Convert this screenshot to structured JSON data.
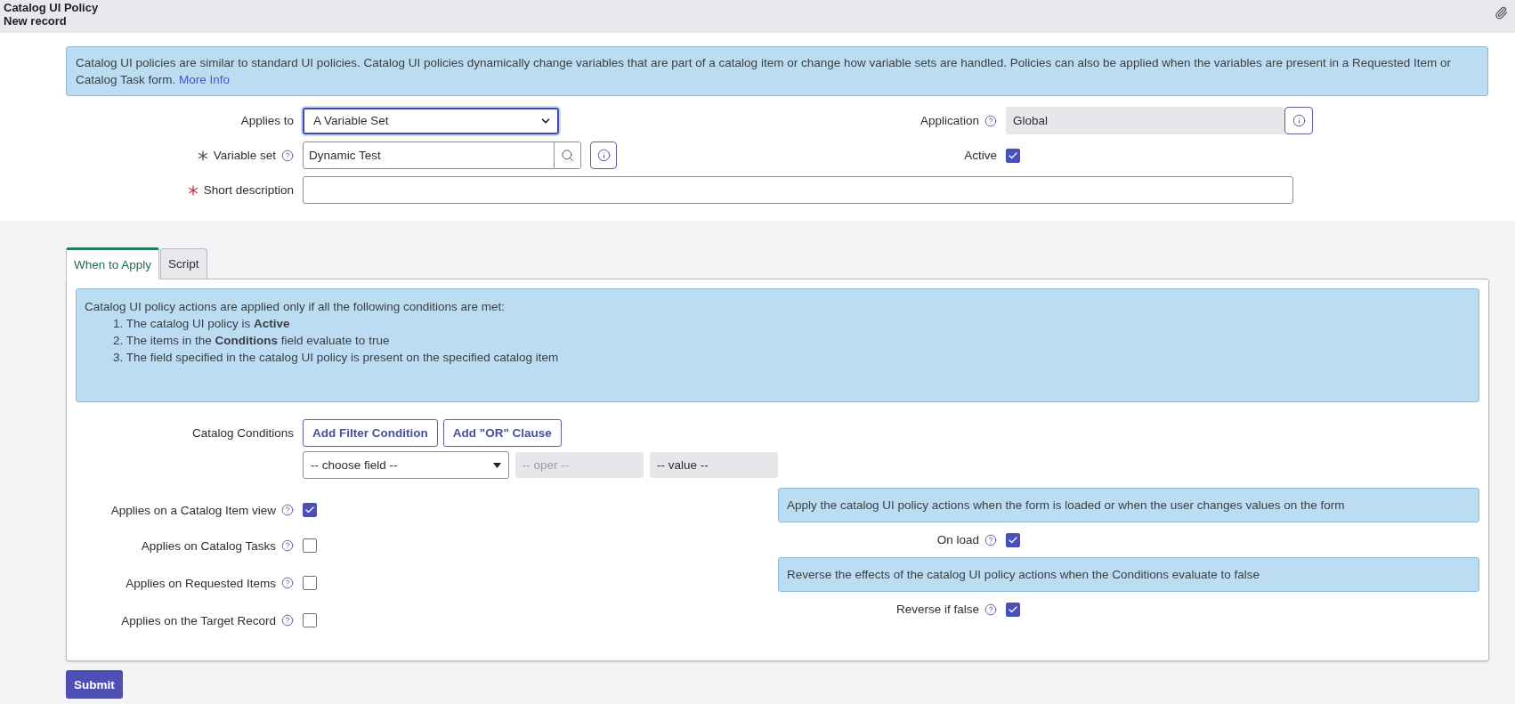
{
  "header": {
    "title": "Catalog UI Policy",
    "subtitle": "New record"
  },
  "intro": {
    "text": "Catalog UI policies are similar to standard UI policies. Catalog UI policies dynamically change variables that are part of a catalog item or change how variable sets are handled. Policies can also be applied when the variables are present in a Requested Item or Catalog Task form.",
    "link": "More Info"
  },
  "form": {
    "applies_to": {
      "label": "Applies to",
      "value": "A Variable Set"
    },
    "variable_set": {
      "label": "Variable set",
      "value": "Dynamic Test",
      "required": true
    },
    "short_description": {
      "label": "Short description",
      "required": true
    },
    "application": {
      "label": "Application",
      "value": "Global"
    },
    "active": {
      "label": "Active",
      "checked": true
    }
  },
  "tabs": [
    {
      "label": "When to Apply",
      "selected": true
    },
    {
      "label": "Script",
      "selected": false
    }
  ],
  "conditions_note": {
    "intro": "Catalog UI policy actions are applied only if all the following conditions are met:",
    "items": [
      "1. The catalog UI policy is **Active**",
      "2. The items in the **Conditions** field evaluate to true",
      "3. The field specified in the catalog UI policy is present on the specified catalog item"
    ]
  },
  "catalog_conditions": {
    "label": "Catalog Conditions",
    "buttons": [
      "Add Filter Condition",
      "Add \"OR\" Clause"
    ],
    "field": "-- choose field --",
    "oper": "-- oper --",
    "value": "-- value --"
  },
  "applies_options": [
    {
      "label": "Applies on a Catalog Item view",
      "checked": true
    },
    {
      "label": "Applies on Catalog Tasks",
      "checked": false
    },
    {
      "label": "Applies on Requested Items",
      "checked": false
    },
    {
      "label": "Applies on the Target Record",
      "checked": false
    }
  ],
  "behaviour_options": [
    {
      "note": "Apply the catalog UI policy actions when the form is loaded or when the user changes values on the form",
      "label": "On load",
      "checked": true
    },
    {
      "note": "Reverse the effects of the catalog UI policy actions when the Conditions evaluate to false",
      "label": "Reverse if false",
      "checked": true
    }
  ],
  "submit": "Submit"
}
